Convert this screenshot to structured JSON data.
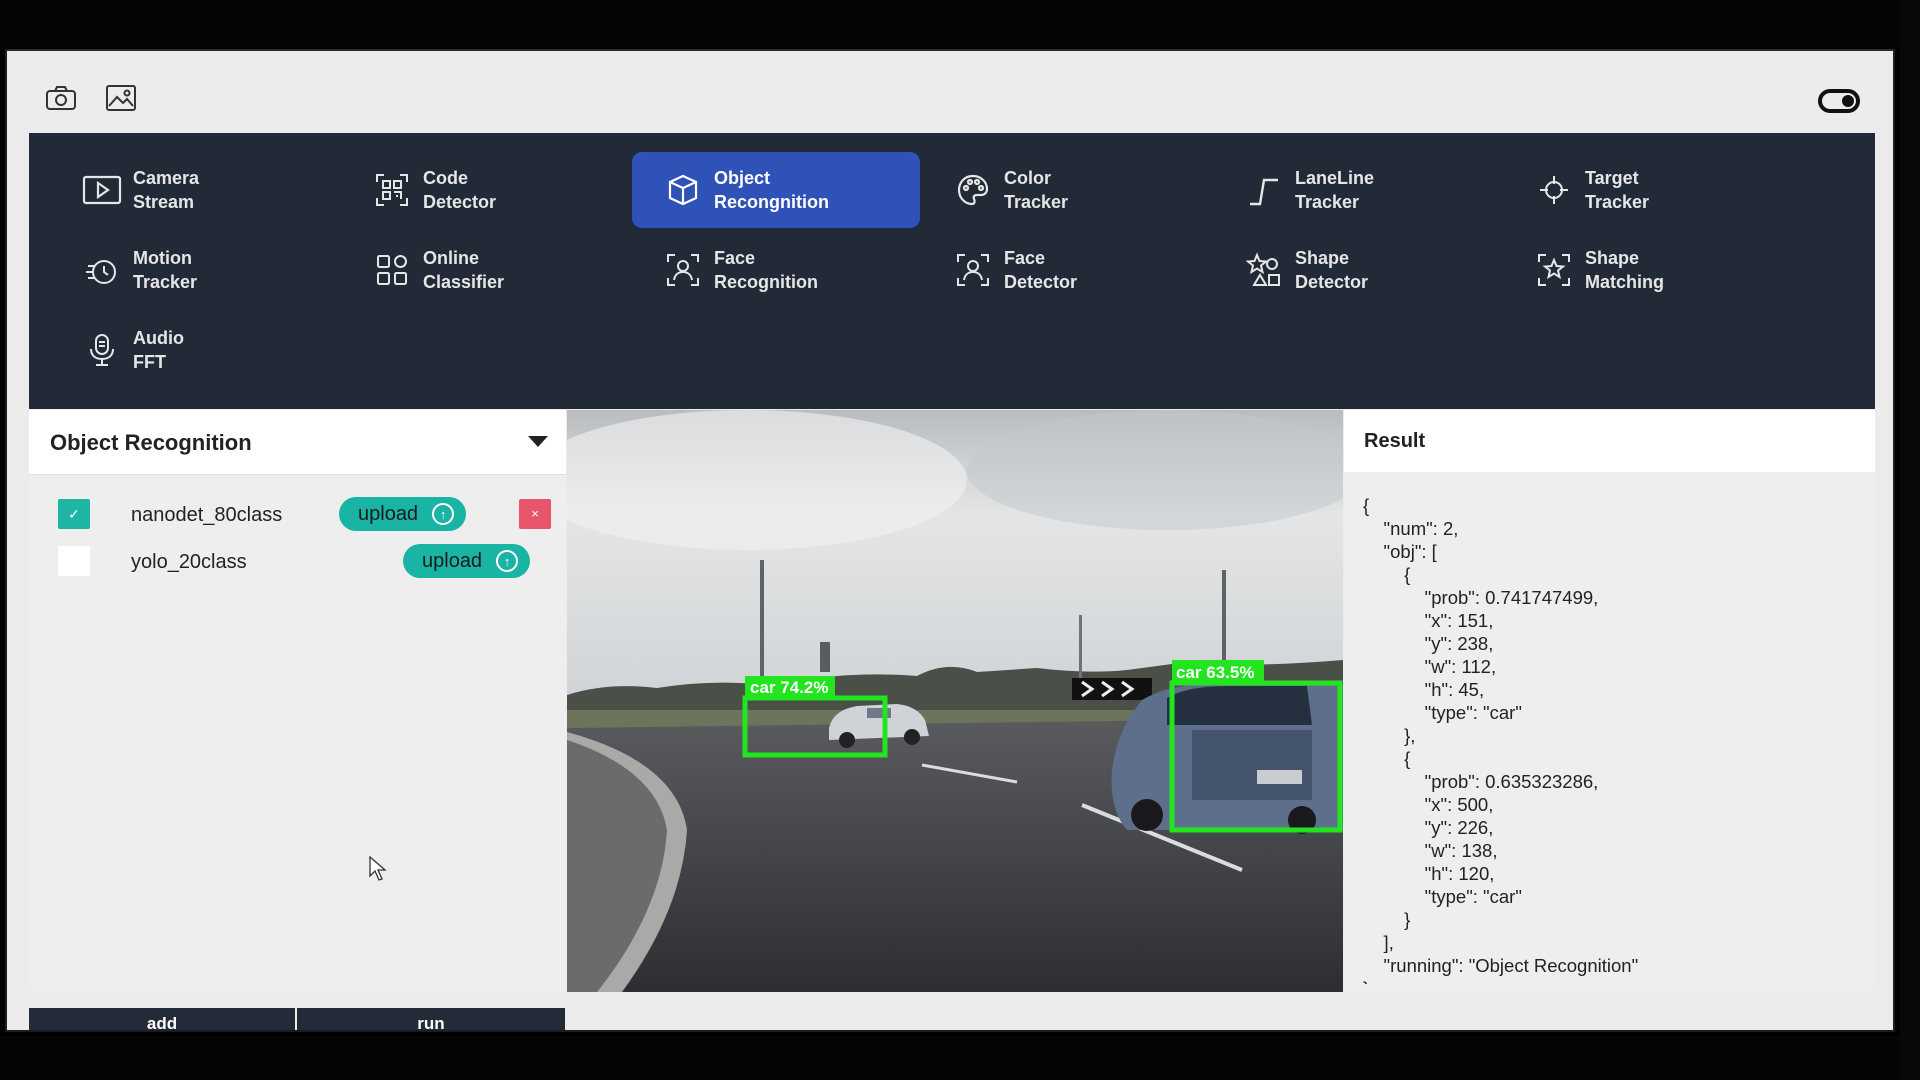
{
  "toolbar": {
    "icons": [
      "camera-icon",
      "image-icon"
    ],
    "toggle": "theme-toggle"
  },
  "nav": {
    "active": "Object Recognition",
    "items": [
      {
        "line1": "Camera",
        "line2": "Stream",
        "icon": "play-icon"
      },
      {
        "line1": "Code",
        "line2": "Detector",
        "icon": "qr-code-icon"
      },
      {
        "line1": "Object",
        "line2": "Recongnition",
        "icon": "cube-icon"
      },
      {
        "line1": "Color",
        "line2": "Tracker",
        "icon": "palette-icon"
      },
      {
        "line1": "LaneLine",
        "line2": "Tracker",
        "icon": "lane-icon"
      },
      {
        "line1": "Target",
        "line2": "Tracker",
        "icon": "crosshair-icon"
      },
      {
        "line1": "Motion",
        "line2": "Tracker",
        "icon": "motion-icon"
      },
      {
        "line1": "Online",
        "line2": "Classifier",
        "icon": "grid-icon"
      },
      {
        "line1": "Face",
        "line2": "Recognition",
        "icon": "face-scan-icon"
      },
      {
        "line1": "Face",
        "line2": "Detector",
        "icon": "face-scan-icon"
      },
      {
        "line1": "Shape",
        "line2": "Detector",
        "icon": "shapes-icon"
      },
      {
        "line1": "Shape",
        "line2": "Matching",
        "icon": "star-scan-icon"
      },
      {
        "line1": "Audio",
        "line2": "FFT",
        "icon": "microphone-icon"
      }
    ]
  },
  "left_panel": {
    "title": "Object Recognition",
    "models": [
      {
        "name": "nanodet_80class",
        "checked": true,
        "upload_label": "upload",
        "deletable": true
      },
      {
        "name": "yolo_20class",
        "checked": false,
        "upload_label": "upload",
        "deletable": false
      }
    ],
    "check_glyph": "✓",
    "delete_glyph": "×",
    "upload_glyph": "↑",
    "add_label": "add",
    "run_label": "run"
  },
  "video": {
    "detections": [
      {
        "label": "car 74.2%"
      },
      {
        "label": "car 63.5%"
      }
    ],
    "box_color": "#22e51f"
  },
  "result": {
    "title": "Result",
    "json_text": "{\n    \"num\": 2,\n    \"obj\": [\n        {\n            \"prob\": 0.741747499,\n            \"x\": 151,\n            \"y\": 238,\n            \"w\": 112,\n            \"h\": 45,\n            \"type\": \"car\"\n        },\n        {\n            \"prob\": 0.635323286,\n            \"x\": 500,\n            \"y\": 226,\n            \"w\": 138,\n            \"h\": 120,\n            \"type\": \"car\"\n        }\n    ],\n    \"running\": \"Object Recognition\"\n}"
  },
  "colors": {
    "nav_bg": "#222a38",
    "nav_active": "#2f52b8",
    "accent": "#19b4a4",
    "danger": "#e8546a"
  }
}
